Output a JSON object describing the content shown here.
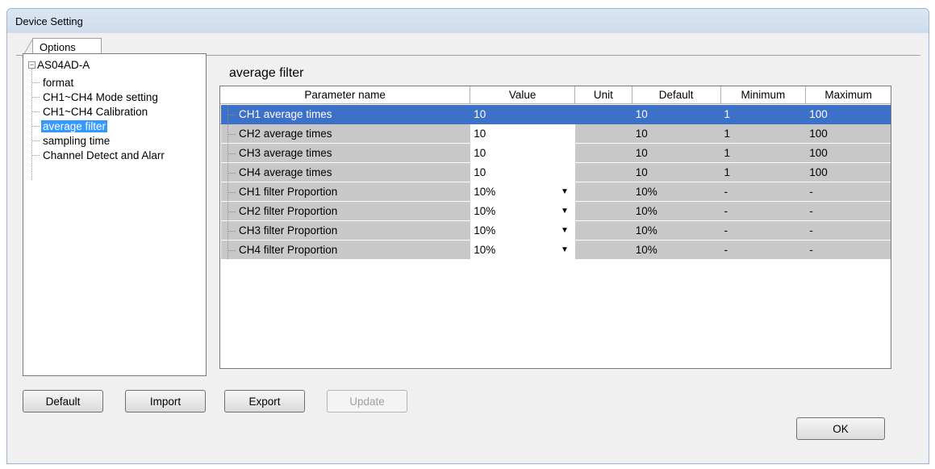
{
  "window": {
    "title": "Device Setting"
  },
  "tabs": [
    {
      "label": "Options"
    }
  ],
  "tree": {
    "root": "AS04AD-A",
    "expander": "⊟",
    "items": [
      {
        "label": "format"
      },
      {
        "label": "CH1~CH4 Mode setting"
      },
      {
        "label": "CH1~CH4 Calibration"
      },
      {
        "label": "average filter"
      },
      {
        "label": "sampling time"
      },
      {
        "label": "Channel Detect and Alarr"
      }
    ],
    "selected_index": 3
  },
  "panel": {
    "title": "average filter"
  },
  "grid": {
    "columns": [
      "Parameter name",
      "Value",
      "Unit",
      "Default",
      "Minimum",
      "Maximum"
    ],
    "rows": [
      {
        "name": "CH1 average times",
        "value": "10",
        "unit": "",
        "default": "10",
        "minimum": "1",
        "maximum": "100",
        "combo": false,
        "selected": true
      },
      {
        "name": "CH2 average times",
        "value": "10",
        "unit": "",
        "default": "10",
        "minimum": "1",
        "maximum": "100",
        "combo": false,
        "selected": false
      },
      {
        "name": "CH3 average times",
        "value": "10",
        "unit": "",
        "default": "10",
        "minimum": "1",
        "maximum": "100",
        "combo": false,
        "selected": false
      },
      {
        "name": "CH4 average times",
        "value": "10",
        "unit": "",
        "default": "10",
        "minimum": "1",
        "maximum": "100",
        "combo": false,
        "selected": false
      },
      {
        "name": "CH1 filter Proportion",
        "value": "10%",
        "unit": "",
        "default": "10%",
        "minimum": "-",
        "maximum": "-",
        "combo": true,
        "selected": false
      },
      {
        "name": "CH2 filter Proportion",
        "value": "10%",
        "unit": "",
        "default": "10%",
        "minimum": "-",
        "maximum": "-",
        "combo": true,
        "selected": false
      },
      {
        "name": "CH3 filter Proportion",
        "value": "10%",
        "unit": "",
        "default": "10%",
        "minimum": "-",
        "maximum": "-",
        "combo": true,
        "selected": false
      },
      {
        "name": "CH4 filter Proportion",
        "value": "10%",
        "unit": "",
        "default": "10%",
        "minimum": "-",
        "maximum": "-",
        "combo": true,
        "selected": false
      }
    ]
  },
  "buttons": {
    "default": "Default",
    "import": "Import",
    "export": "Export",
    "update": "Update",
    "ok": "OK"
  },
  "colors": {
    "selection": "#3c71c7",
    "tree_selection": "#3399ff",
    "readonly_cell": "#c8c8c8"
  }
}
